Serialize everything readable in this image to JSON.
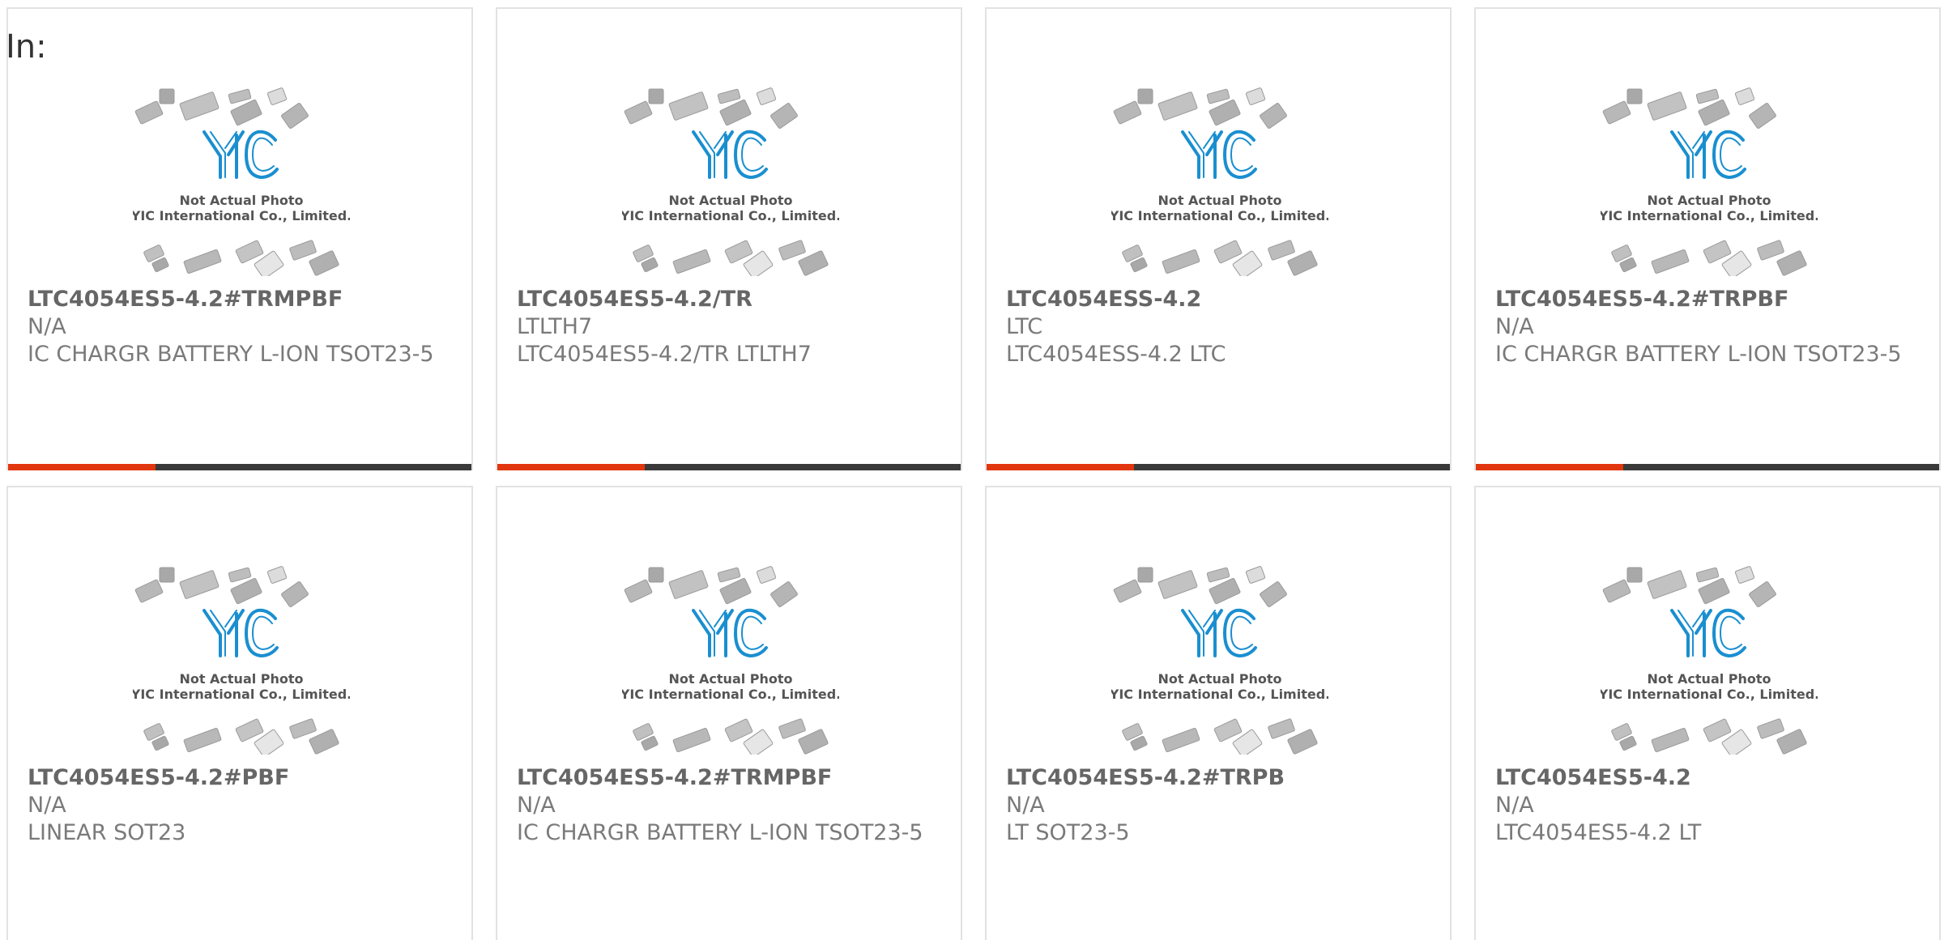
{
  "page": {
    "label": "In:"
  },
  "thumbnail": {
    "logo_text": "YIC",
    "caption_line1": "Not Actual Photo",
    "caption_line2": "YIC International Co., Limited."
  },
  "colors": {
    "accent": "#e2360e",
    "bar_dark": "#3a3a3a",
    "logo_blue": "#1a8fd0",
    "text_gray": "#7a7a7a",
    "border": "#e2e2e2"
  },
  "products": [
    {
      "part_number": "LTC4054ES5-4.2#TRMPBF",
      "manufacturer": "N/A",
      "description": "IC CHARGR BATTERY L-ION TSOT23-5"
    },
    {
      "part_number": "LTC4054ES5-4.2/TR",
      "manufacturer": "LTLTH7",
      "description": "LTC4054ES5-4.2/TR LTLTH7"
    },
    {
      "part_number": "LTC4054ESS-4.2",
      "manufacturer": "LTC",
      "description": "LTC4054ESS-4.2 LTC"
    },
    {
      "part_number": "LTC4054ES5-4.2#TRPBF",
      "manufacturer": "N/A",
      "description": "IC CHARGR BATTERY L-ION TSOT23-5"
    },
    {
      "part_number": "LTC4054ES5-4.2#PBF",
      "manufacturer": "N/A",
      "description": "LINEAR SOT23"
    },
    {
      "part_number": "LTC4054ES5-4.2#TRMPBF",
      "manufacturer": "N/A",
      "description": "IC CHARGR BATTERY L-ION TSOT23-5"
    },
    {
      "part_number": "LTC4054ES5-4.2#TRPB",
      "manufacturer": "N/A",
      "description": "LT SOT23-5"
    },
    {
      "part_number": "LTC4054ES5-4.2",
      "manufacturer": "N/A",
      "description": "LTC4054ES5-4.2 LT"
    }
  ]
}
